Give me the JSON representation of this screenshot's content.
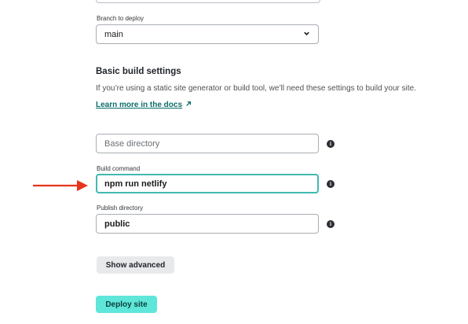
{
  "branch": {
    "label": "Branch to deploy",
    "selected": "main"
  },
  "build_settings": {
    "heading": "Basic build settings",
    "description": "If you’re using a static site generator or build tool, we’ll need these settings to build your site.",
    "docs_link": "Learn more in the docs",
    "docs_link_icon": "external-arrow-icon",
    "fields": {
      "base_directory": {
        "label": "",
        "placeholder": "Base directory",
        "value": ""
      },
      "build_command": {
        "label": "Build command",
        "value": "npm run netlify"
      },
      "publish_directory": {
        "label": "Publish directory",
        "value": "public"
      }
    },
    "info_icon": "info-icon"
  },
  "actions": {
    "show_advanced": "Show advanced",
    "deploy_site": "Deploy site"
  },
  "annotation": {
    "icon": "red-arrow-icon",
    "color": "#e8341c"
  },
  "colors": {
    "primary_button": "#5ee6d9",
    "focus_border": "#41b9b0",
    "link": "#0b6e69"
  }
}
